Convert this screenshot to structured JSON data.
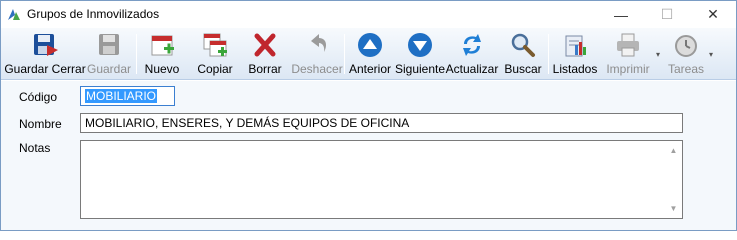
{
  "window": {
    "title": "Grupos de Inmovilizados",
    "min_glyph": "—",
    "max_glyph": "☐",
    "close_glyph": "✕"
  },
  "toolbar": {
    "buttons": [
      {
        "label": "Guardar Cerrar",
        "icon": "save-close-icon",
        "enabled": true
      },
      {
        "label": "Guardar",
        "icon": "save-icon",
        "enabled": false
      },
      {
        "label": "Nuevo",
        "icon": "new-icon",
        "enabled": true
      },
      {
        "label": "Copiar",
        "icon": "copy-icon",
        "enabled": true
      },
      {
        "label": "Borrar",
        "icon": "delete-icon",
        "enabled": true
      },
      {
        "label": "Deshacer",
        "icon": "undo-icon",
        "enabled": false
      },
      {
        "label": "Anterior",
        "icon": "arrow-up-icon",
        "enabled": true
      },
      {
        "label": "Siguiente",
        "icon": "arrow-down-icon",
        "enabled": true
      },
      {
        "label": "Actualizar",
        "icon": "refresh-icon",
        "enabled": true
      },
      {
        "label": "Buscar",
        "icon": "search-icon",
        "enabled": true
      },
      {
        "label": "Listados",
        "icon": "reports-icon",
        "enabled": true
      },
      {
        "label": "Imprimir",
        "icon": "printer-icon",
        "enabled": false
      },
      {
        "label": "Tareas",
        "icon": "clock-icon",
        "enabled": false
      }
    ],
    "dropdown_glyph": "▾"
  },
  "form": {
    "codigo_label": "Código",
    "codigo_value": "MOBILIARIO",
    "nombre_label": "Nombre",
    "nombre_value": "MOBILIARIO, ENSERES, Y DEMÁS EQUIPOS DE OFICINA",
    "notas_label": "Notas",
    "notas_value": "",
    "scroll_up_glyph": "▲",
    "scroll_down_glyph": "▼"
  },
  "colors": {
    "accent": "#3399ff",
    "toolbar_top": "#f7fafd",
    "toolbar_bottom": "#dce7f4",
    "delete_red": "#c0262d",
    "nav_blue": "#1f6fc4",
    "new_red": "#c62d2d",
    "plus_green": "#3aa63a"
  }
}
